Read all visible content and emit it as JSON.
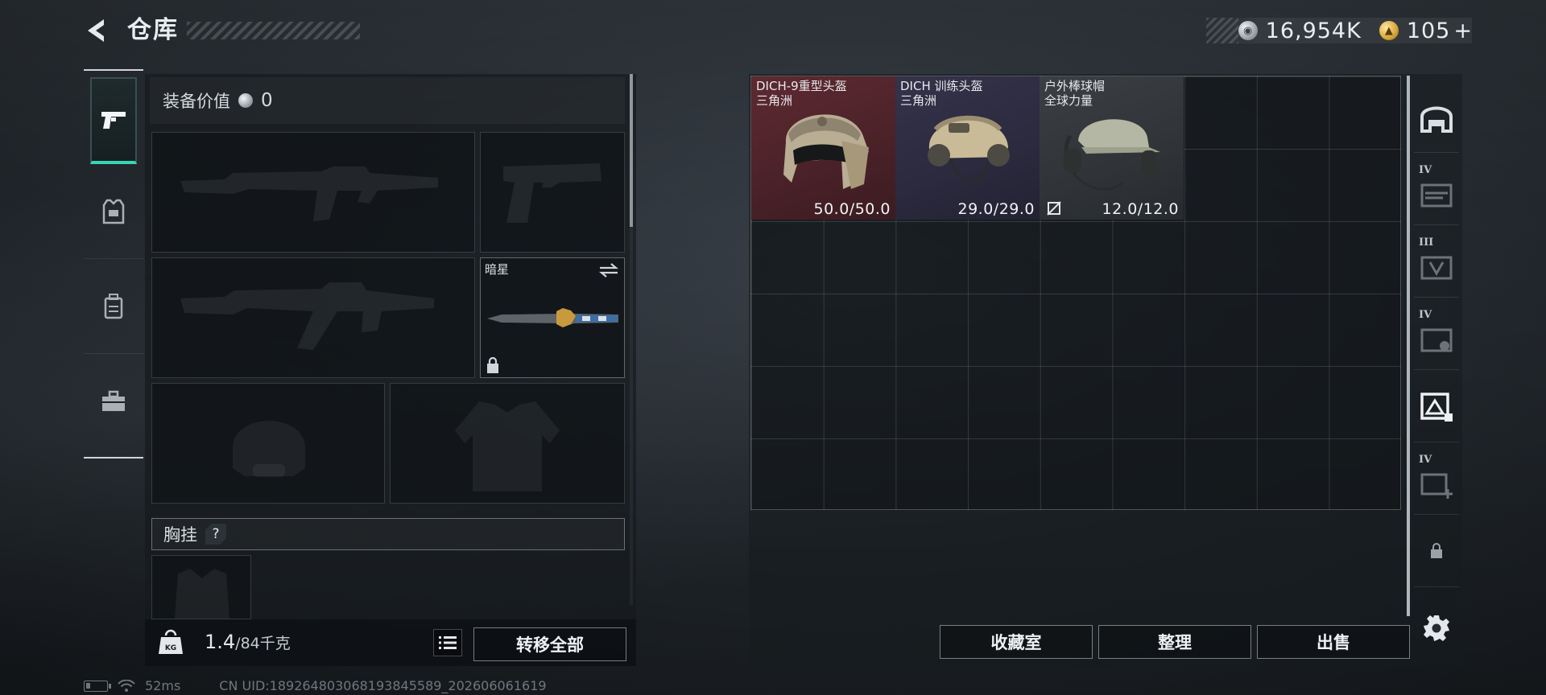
{
  "header": {
    "title": "仓库",
    "currencies": [
      {
        "icon": "silver-coin-icon",
        "value": "16,954K"
      },
      {
        "icon": "gold-coin-icon",
        "value": "105",
        "suffix": "+"
      }
    ]
  },
  "left_nav": {
    "items": [
      {
        "icon": "pistol-icon",
        "active": true
      },
      {
        "icon": "armor-vest-icon",
        "active": false
      },
      {
        "icon": "backpack-icon",
        "active": false
      },
      {
        "icon": "toolbox-icon",
        "active": false
      }
    ]
  },
  "equipment": {
    "value_label": "装备价值",
    "value": "0",
    "melee_slot": {
      "name": "暗星"
    },
    "chest_rig_label": "胸挂",
    "chest_rig_help": "?",
    "weight_value": "1.4",
    "weight_max": "/84千克",
    "transfer_all_label": "转移全部"
  },
  "storage": {
    "items": [
      {
        "name": "DICH-9重型头盔",
        "origin": "三角洲",
        "durability": "50.0/50.0",
        "rarity": "red"
      },
      {
        "name": "DICH 训练头盔",
        "origin": "三角洲",
        "durability": "29.0/29.0",
        "rarity": "purple"
      },
      {
        "name": "户外棒球帽",
        "origin": "全球力量",
        "durability": "12.0/12.0",
        "rarity": "gray"
      }
    ],
    "buttons": {
      "collection": "收藏室",
      "organize": "整理",
      "sell": "出售"
    }
  },
  "right_rail": {
    "tabs": [
      {
        "icon": "helmet-category-icon",
        "tier": ""
      },
      {
        "icon": "rifle-crate-icon",
        "tier": "IV"
      },
      {
        "icon": "gear-crate-icon",
        "tier": "III"
      },
      {
        "icon": "medical-crate-icon",
        "tier": "IV"
      },
      {
        "icon": "collection-box-icon",
        "tier": ""
      },
      {
        "icon": "add-container-icon",
        "tier": "IV"
      },
      {
        "icon": "lock-icon",
        "tier": ""
      }
    ]
  },
  "status_bar": {
    "ping": "52ms",
    "uid": "CN UID:1892648030681938455​89_202606061619"
  }
}
